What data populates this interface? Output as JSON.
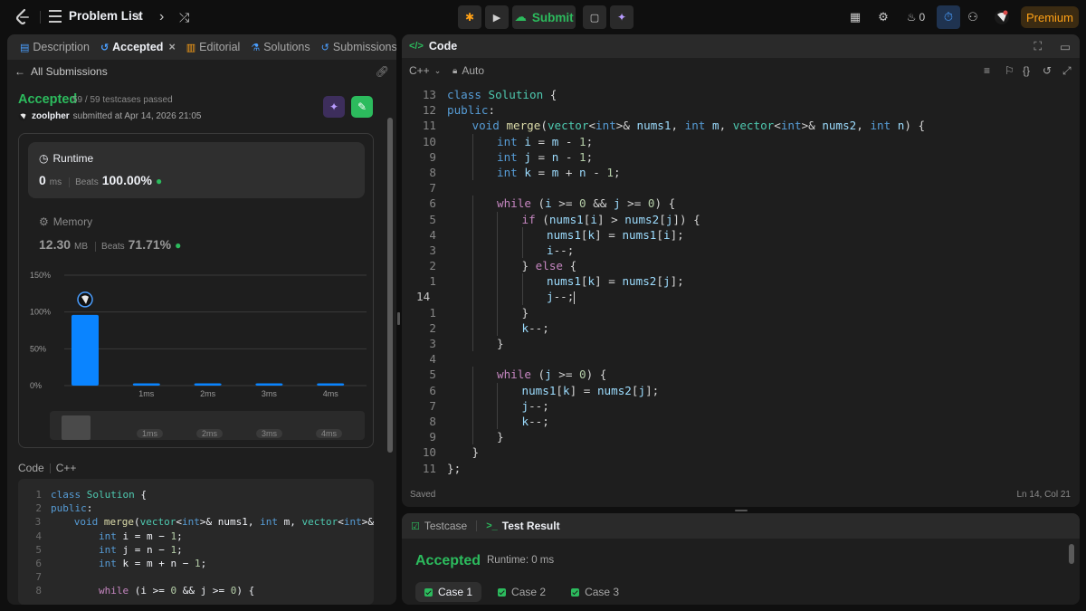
{
  "topbar": {
    "problem_list": "Problem List",
    "submit": "Submit",
    "streak": "0",
    "premium": "Premium"
  },
  "left": {
    "tabs": [
      "Description",
      "Accepted",
      "Editorial",
      "Solutions",
      "Submissions"
    ],
    "all_submissions": "All Submissions",
    "status": "Accepted",
    "testcases": "59 / 59 testcases passed",
    "username": "zoolpher",
    "submitted_at": "submitted at Apr 14, 2026 21:05",
    "runtime_label": "Runtime",
    "runtime_value": "0",
    "runtime_unit": "ms",
    "runtime_beats_label": "Beats",
    "runtime_beats": "100.00%",
    "memory_label": "Memory",
    "memory_value": "12.30",
    "memory_unit": "MB",
    "memory_beats_label": "Beats",
    "memory_beats": "71.71%",
    "code_label": "Code",
    "code_lang": "C++",
    "code_lines": [
      {
        "n": "1",
        "text": "class Solution {"
      },
      {
        "n": "2",
        "text": "public:"
      },
      {
        "n": "3",
        "text": "    void merge(vector<int>& nums1, int m, vector<int>&"
      },
      {
        "n": "4",
        "text": "        int i = m − 1;"
      },
      {
        "n": "5",
        "text": "        int j = n − 1;"
      },
      {
        "n": "6",
        "text": "        int k = m + n − 1;"
      },
      {
        "n": "7",
        "text": ""
      },
      {
        "n": "8",
        "text": "        while (i >= 0 && j >= 0) {"
      }
    ]
  },
  "chart_data": {
    "type": "bar",
    "categories": [
      "",
      "1ms",
      "2ms",
      "3ms",
      "4ms"
    ],
    "values": [
      96,
      3,
      3,
      3,
      3
    ],
    "yticks": [
      "150%",
      "100%",
      "50%",
      "0%"
    ],
    "ylim": [
      0,
      150
    ],
    "scroller_labels": [
      "1ms",
      "2ms",
      "3ms",
      "4ms"
    ],
    "colors": {
      "bar": "#0a84ff",
      "grid": "#3a3a3a"
    }
  },
  "editor": {
    "title": "Code",
    "language": "C++",
    "mode": "Auto",
    "saved": "Saved",
    "cursor": "Ln 14, Col 21",
    "lines": [
      {
        "n": "13",
        "indent": 0,
        "html": "<span class='k'>class</span> <span class='t'>Solution</span> {"
      },
      {
        "n": "12",
        "indent": 0,
        "html": "<span class='k'>public</span>:"
      },
      {
        "n": "11",
        "indent": 1,
        "html": "<span class='k'>void</span> <span class='f'>merge</span>(<span class='t'>vector</span>&lt;<span class='k'>int</span>&gt;&amp; <span class='v'>nums1</span>, <span class='k'>int</span> <span class='v'>m</span>, <span class='t'>vector</span>&lt;<span class='k'>int</span>&gt;&amp; <span class='v'>nums2</span>, <span class='k'>int</span> <span class='v'>n</span>) {"
      },
      {
        "n": "10",
        "indent": 2,
        "html": "<span class='k'>int</span> <span class='v'>i</span> = <span class='v'>m</span> - <span class='n'>1</span>;"
      },
      {
        "n": "9",
        "indent": 2,
        "html": "<span class='k'>int</span> <span class='v'>j</span> = <span class='v'>n</span> - <span class='n'>1</span>;"
      },
      {
        "n": "8",
        "indent": 2,
        "html": "<span class='k'>int</span> <span class='v'>k</span> = <span class='v'>m</span> + <span class='v'>n</span> - <span class='n'>1</span>;"
      },
      {
        "n": "7",
        "indent": 0,
        "html": ""
      },
      {
        "n": "6",
        "indent": 2,
        "html": "<span class='c'>while</span> (<span class='v'>i</span> &gt;= <span class='n'>0</span> &amp;&amp; <span class='v'>j</span> &gt;= <span class='n'>0</span>) {"
      },
      {
        "n": "5",
        "indent": 3,
        "html": "<span class='c'>if</span> (<span class='v'>nums1</span>[<span class='v'>i</span>] &gt; <span class='v'>nums2</span>[<span class='v'>j</span>]) {"
      },
      {
        "n": "4",
        "indent": 4,
        "html": "<span class='v'>nums1</span>[<span class='v'>k</span>] = <span class='v'>nums1</span>[<span class='v'>i</span>];"
      },
      {
        "n": "3",
        "indent": 4,
        "html": "<span class='v'>i</span>--;"
      },
      {
        "n": "2",
        "indent": 3,
        "html": "} <span class='c'>else</span> {"
      },
      {
        "n": "1",
        "indent": 4,
        "html": "<span class='v'>nums1</span>[<span class='v'>k</span>] = <span class='v'>nums2</span>[<span class='v'>j</span>];"
      },
      {
        "n": "14",
        "indent": 4,
        "cur": true,
        "html": "<span class='v'>j</span>--;"
      },
      {
        "n": "1",
        "indent": 3,
        "html": "}"
      },
      {
        "n": "2",
        "indent": 3,
        "html": "<span class='v'>k</span>--;"
      },
      {
        "n": "3",
        "indent": 2,
        "html": "}"
      },
      {
        "n": "4",
        "indent": 0,
        "html": ""
      },
      {
        "n": "5",
        "indent": 2,
        "html": "<span class='c'>while</span> (<span class='v'>j</span> &gt;= <span class='n'>0</span>) {"
      },
      {
        "n": "6",
        "indent": 3,
        "html": "<span class='v'>nums1</span>[<span class='v'>k</span>] = <span class='v'>nums2</span>[<span class='v'>j</span>];"
      },
      {
        "n": "7",
        "indent": 3,
        "html": "<span class='v'>j</span>--;"
      },
      {
        "n": "8",
        "indent": 3,
        "html": "<span class='v'>k</span>--;"
      },
      {
        "n": "9",
        "indent": 2,
        "html": "}"
      },
      {
        "n": "10",
        "indent": 1,
        "html": "}"
      },
      {
        "n": "11",
        "indent": 0,
        "html": "};"
      }
    ]
  },
  "result": {
    "tab_testcase": "Testcase",
    "tab_result": "Test Result",
    "status": "Accepted",
    "runtime": "Runtime: 0 ms",
    "cases": [
      "Case 1",
      "Case 2",
      "Case 3"
    ]
  }
}
